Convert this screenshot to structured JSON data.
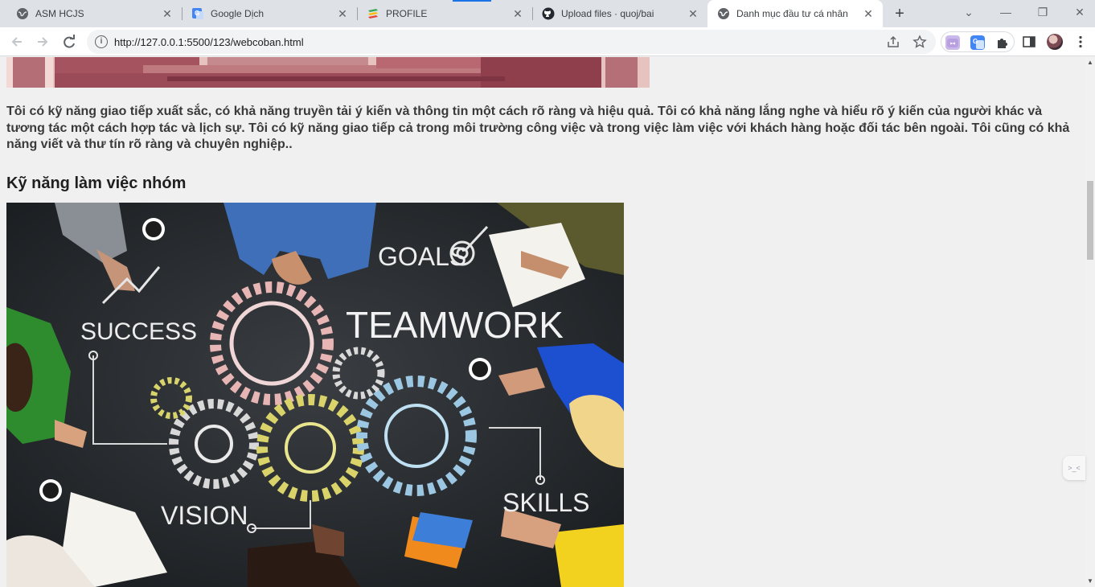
{
  "browser": {
    "tabs": [
      {
        "title": "ASM HCJS",
        "icon": "globe-icon"
      },
      {
        "title": "Google Dịch",
        "icon": "google-translate-icon"
      },
      {
        "title": "PROFILE",
        "icon": "stack-icon"
      },
      {
        "title": "Upload files · quoj/bai",
        "icon": "github-icon"
      },
      {
        "title": "Danh mục đầu tư cá nhân",
        "icon": "globe-icon",
        "active": true
      }
    ],
    "new_tab_symbol": "+",
    "close_symbol": "✕",
    "window": {
      "minimize": "—",
      "restore": "❐",
      "close": "✕",
      "dropdown": "⌄"
    },
    "url": "http://127.0.0.1:5500/123/webcoban.html",
    "accent": "#1a73e8"
  },
  "page": {
    "paragraph": "Tôi có kỹ năng giao tiếp xuất sắc, có khả năng truyền tải ý kiến và thông tin một cách rõ ràng và hiệu quả. Tôi có khả năng lắng nghe và hiểu rõ ý kiến của người khác và tương tác một cách hợp tác và lịch sự. Tôi có kỹ năng giao tiếp cả trong môi trường công việc và trong việc làm việc với khách hàng hoặc đối tác bên ngoài. Tôi cũng có khả năng viết và thư tín rõ ràng và chuyên nghiệp..",
    "section_heading": "Kỹ năng làm việc nhóm",
    "image_words": {
      "goals": "GOALS",
      "teamwork": "TEAMWORK",
      "success": "SUCCESS",
      "vision": "VISION",
      "skills": "SKILLS"
    }
  },
  "side_widget": {
    "text": ">_<"
  }
}
